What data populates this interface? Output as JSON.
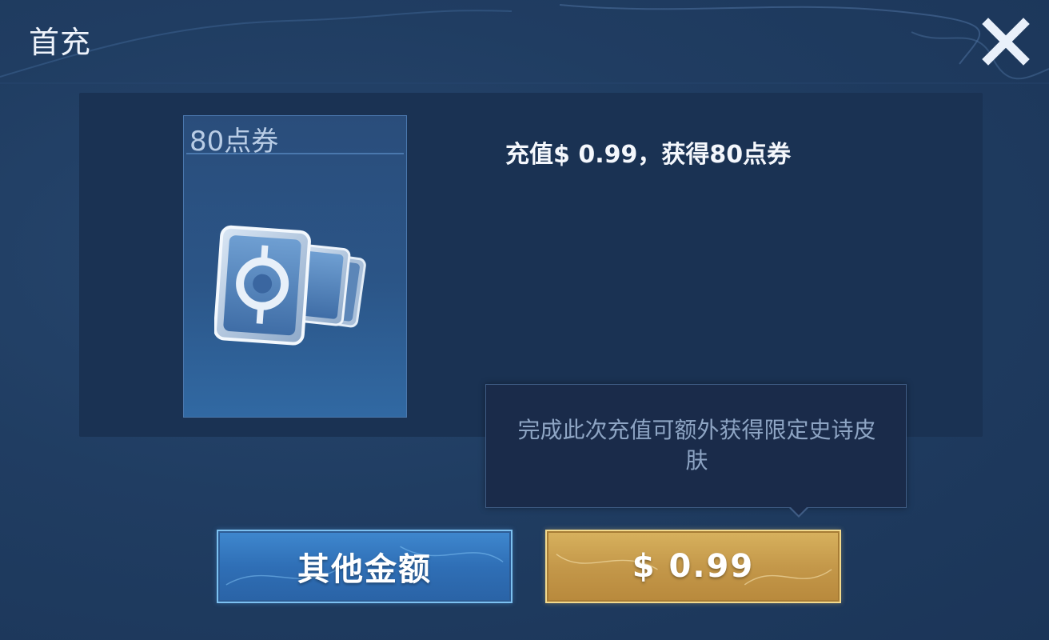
{
  "header": {
    "title": "首充",
    "close_icon": "close-icon"
  },
  "item_card": {
    "label": "80点券",
    "icon": "coupon-cards-icon"
  },
  "description": "充值$ 0.99，获得80点券",
  "tooltip": {
    "text": "完成此次充值可额外获得限定史诗皮肤"
  },
  "buttons": {
    "other_amount_label": "其他金额",
    "price_label": "$ 0.99"
  },
  "colors": {
    "background": "#203d62",
    "panel": "#1a3253",
    "blue_button": "#2f6fb6",
    "gold_button": "#c4984a",
    "tooltip_bg": "#1a2b4a"
  }
}
